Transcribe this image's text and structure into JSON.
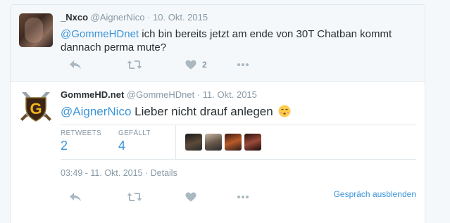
{
  "reply_tweet": {
    "name": "_Nxco",
    "handle": "@AignerNico",
    "separator": "·",
    "date": "10. Okt. 2015",
    "mention": "@GommeHDnet",
    "text": " ich bin bereits jetzt am ende von 30T Chatban kommt dannach perma mute?",
    "like_count": "2"
  },
  "main_tweet": {
    "name": "GommeHD.net",
    "handle": "@GommeHDnet",
    "separator": "·",
    "date": "11. Okt. 2015",
    "mention": "@AignerNico",
    "text": " Lieber nicht drauf anlegen",
    "emoji_icon": "kissing-face-icon",
    "retweets_label": "RETWEETS",
    "retweets_value": "2",
    "likes_label": "GEFÄLLT",
    "likes_value": "4",
    "timestamp": "03:49 - 11. Okt. 2015",
    "meta_separator": " · ",
    "details_label": "Details",
    "hide_conversation_label": "Gespräch ausblenden"
  },
  "icons": {
    "reply": "reply-icon",
    "retweet": "retweet-icon",
    "like": "heart-icon",
    "more": "more-icon"
  },
  "colors": {
    "link": "#3b94d9",
    "muted": "#8899a6",
    "background": "#f5f8fa",
    "border": "#e1e8ed"
  }
}
